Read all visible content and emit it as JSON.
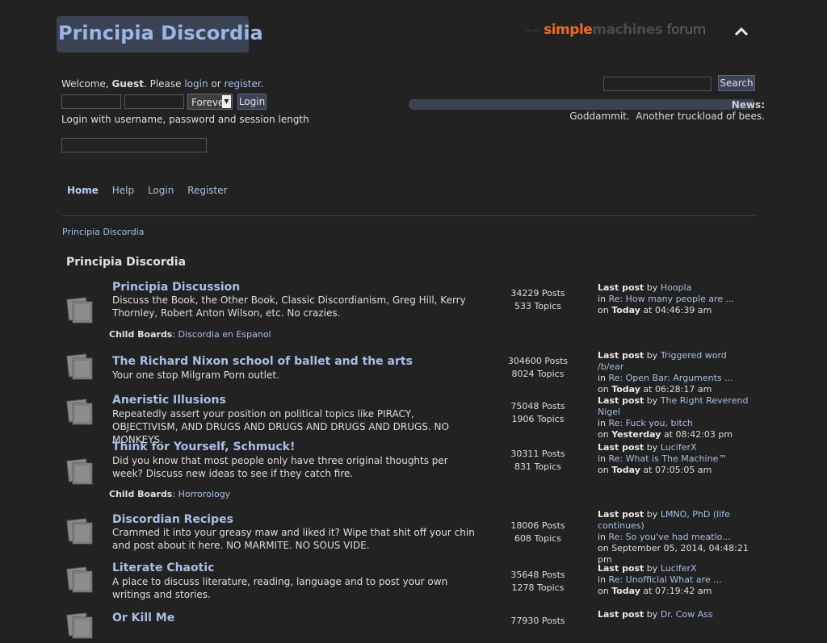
{
  "header": {
    "forum_title": "Principia Discordia",
    "logo": {
      "word1": "simple",
      "word2": "machines",
      "word3": "forum"
    },
    "collapse_icon": "chevron-up-icon"
  },
  "user": {
    "welcome_prefix": "Welcome, ",
    "guest": "Guest",
    "please": ". Please ",
    "login_link": "login",
    "or": " or ",
    "register_link": "register",
    "period": ".",
    "username_value": "",
    "password_value": "",
    "session_value": "Forever",
    "login_button": "Login",
    "login_hint": "Login with username, password and session length",
    "openid_value": ""
  },
  "search": {
    "value": "",
    "button": "Search"
  },
  "news": {
    "label": "News:",
    "text": "Goddammit.  Another truckload of bees."
  },
  "menu": {
    "items": [
      "Home",
      "Help",
      "Login",
      "Register"
    ]
  },
  "breadcrumb": "Principia Discordia",
  "category": {
    "title": "Principia Discordia"
  },
  "boards": [
    {
      "title": "Principia Discussion",
      "description": "Discuss the Book, the Other Book, Classic Discordianism, Greg Hill, Kerry Thornley, Robert Anton Wilson, etc. No crazies.",
      "posts": "34229 Posts",
      "topics": "533 Topics",
      "last_label": "Last post",
      "by": " by ",
      "last_user": "Hoopla",
      "in": "in ",
      "last_topic": "Re: How many people are ...",
      "on": "on ",
      "last_day": "Today",
      "last_time": " at 04:46:39 am",
      "child_label": "Child Boards",
      "child_boards": "Discordia en Espanol"
    },
    {
      "title": "The Richard Nixon school of ballet and the arts",
      "description": "Your one stop Milgram Porn outlet.",
      "posts": "304600 Posts",
      "topics": "8024 Topics",
      "last_label": "Last post",
      "by": " by ",
      "last_user": "Triggered word /b/ear",
      "in": "in ",
      "last_topic": "Re: Open Bar: Arguments ...",
      "on": "on ",
      "last_day": "Today",
      "last_time": " at 06:28:17 am"
    },
    {
      "title": "Aneristic Illusions",
      "description": "Repeatedly assert your position on political topics like PIRACY, OBJECTIVISM, AND DRUGS AND DRUGS AND DRUGS AND DRUGS. NO MONKEYS.",
      "posts": "75048 Posts",
      "topics": "1906 Topics",
      "last_label": "Last post",
      "by": " by ",
      "last_user": "The Right Reverend Nigel",
      "in": "in ",
      "last_topic": "Re: Fuck you, bitch",
      "on": "on ",
      "last_day": "Yesterday",
      "last_time": " at 08:42:03 pm"
    },
    {
      "title": "Think for Yourself, Schmuck!",
      "description": "Did you know that most people only have three original thoughts per week? Discuss new ideas to see if they catch fire.",
      "posts": "30311 Posts",
      "topics": "831 Topics",
      "last_label": "Last post",
      "by": " by ",
      "last_user": "LuciferX",
      "in": "in ",
      "last_topic": "Re: What is The Machine™",
      "on": "on ",
      "last_day": "Today",
      "last_time": " at 07:05:05 am",
      "child_label": "Child Boards",
      "child_boards": "Horrorology"
    },
    {
      "title": "Discordian Recipes",
      "description": "Crammed it into your greasy maw and liked it? Wipe that shit off your chin and post about it here. NO MARMITE. NO SOUS VIDE.",
      "posts": "18006 Posts",
      "topics": "608 Topics",
      "last_label": "Last post",
      "by": " by ",
      "last_user": "LMNO, PhD (life continues)",
      "in": "in ",
      "last_topic": "Re: So you've had meatlo...",
      "on": "on ",
      "last_day": "",
      "last_time": "September 05, 2014, 04:48:21 pm"
    },
    {
      "title": "Literate Chaotic",
      "description": "A place to discuss literature, reading, language and to post your own writings and stories.",
      "posts": "35648 Posts",
      "topics": "1278 Topics",
      "last_label": "Last post",
      "by": " by ",
      "last_user": "LuciferX",
      "in": "in ",
      "last_topic": "Re: Unofficial What are ...",
      "on": "on ",
      "last_day": "Today",
      "last_time": " at 07:19:42 am"
    },
    {
      "title": "Or Kill Me",
      "posts": "77930 Posts",
      "last_label": "Last post",
      "by": " by ",
      "last_user": "Dr. Cow Ass"
    }
  ]
}
